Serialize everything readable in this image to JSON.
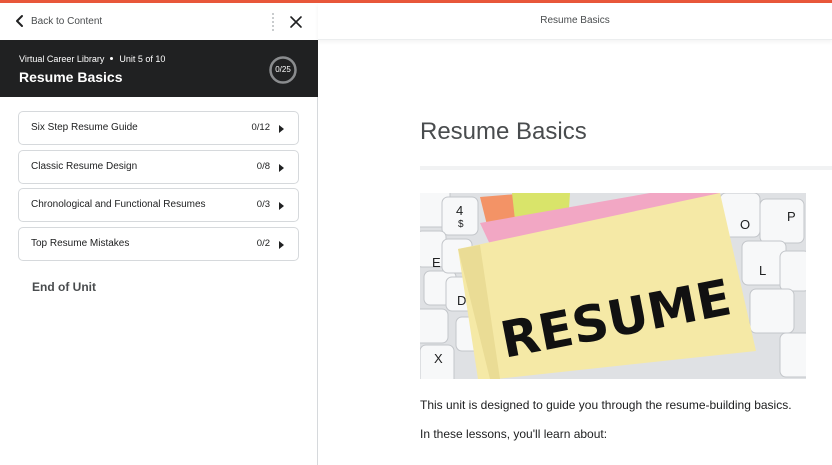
{
  "left_panel": {
    "back_label": "Back to Content",
    "unit": {
      "library": "Virtual Career Library",
      "unit_label": "Unit 5 of 10",
      "title": "Resume Basics",
      "progress": "0/25"
    },
    "lessons": [
      {
        "name": "Six Step Resume Guide",
        "count": "0/12"
      },
      {
        "name": "Classic Resume Design",
        "count": "0/8"
      },
      {
        "name": "Chronological and Functional Resumes",
        "count": "0/3"
      },
      {
        "name": "Top Resume Mistakes",
        "count": "0/2"
      }
    ],
    "end_label": "End of Unit"
  },
  "right_panel": {
    "topbar_title": "Resume Basics",
    "content_title": "Resume Basics",
    "hero_text": "RESUME",
    "paragraphs": [
      "This unit is designed to guide you through the resume-building basics.",
      "In these lessons, you'll learn about:"
    ]
  },
  "colors": {
    "accent": "#e8573a",
    "header_bg": "#202122",
    "text": "#202122",
    "muted": "#494c4e"
  },
  "icons": [
    "chevron-left-icon",
    "more-vertical-icon",
    "close-icon",
    "progress-ring-icon",
    "caret-right-icon"
  ]
}
